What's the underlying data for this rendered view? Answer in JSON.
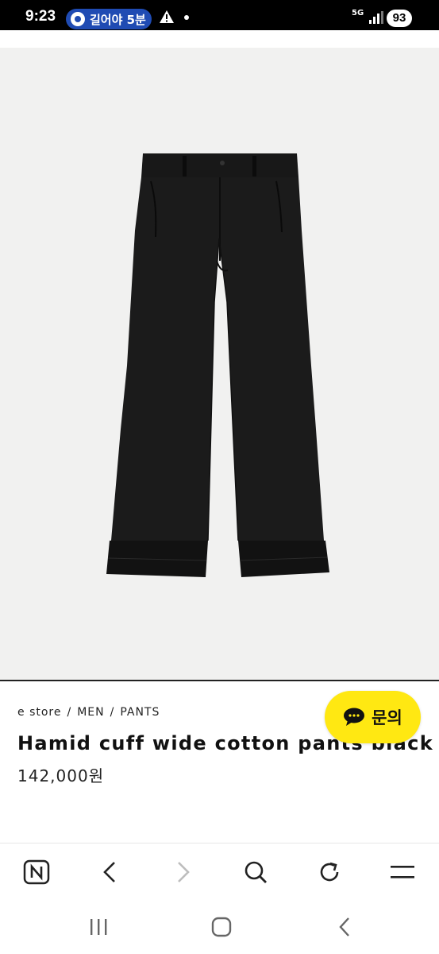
{
  "status_bar": {
    "time": "9:23",
    "nav_pill_text": "길어야 5분",
    "network": "5G",
    "battery": "93"
  },
  "product_image": {
    "icon": "pants-image",
    "background": "#f1f1f0",
    "item_color": "#1a1a1a"
  },
  "breadcrumb": [
    "e store",
    "MEN",
    "PANTS"
  ],
  "breadcrumb_separator": "/",
  "product": {
    "title": "Hamid cuff wide cotton pants black",
    "price": "142,000원"
  },
  "chat_button": {
    "label": "문의",
    "color": "#ffe812",
    "icon": "speech-bubble-icon"
  },
  "browser_toolbar": [
    {
      "name": "naver-home-icon"
    },
    {
      "name": "back-arrow-icon"
    },
    {
      "name": "forward-arrow-icon"
    },
    {
      "name": "search-icon"
    },
    {
      "name": "refresh-icon"
    },
    {
      "name": "menu-icon"
    }
  ],
  "system_nav": [
    {
      "name": "recent-apps-icon"
    },
    {
      "name": "home-icon"
    },
    {
      "name": "back-icon"
    }
  ]
}
